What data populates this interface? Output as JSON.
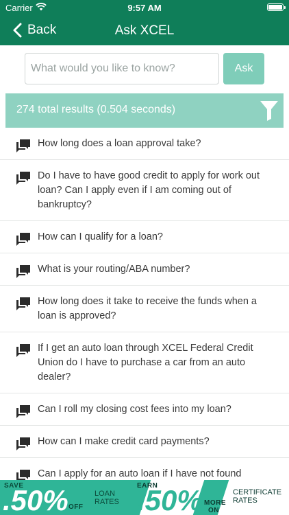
{
  "status_bar": {
    "carrier": "Carrier",
    "time": "9:57 AM"
  },
  "nav": {
    "back_label": "Back",
    "title": "Ask XCEL"
  },
  "search": {
    "placeholder": "What would you like to know?",
    "value": "",
    "ask_label": "Ask"
  },
  "results": {
    "summary": "274 total results (0.504 seconds)"
  },
  "questions": [
    "How long does a loan approval take?",
    "Do I have to have good credit to apply for work out loan? Can I apply even if I am coming out of bankruptcy?",
    "How can I qualify for a loan?",
    "What is your routing/ABA number?",
    "How long does it take to receive the funds when a loan is approved?",
    "If I get an auto loan through XCEL Federal Credit Union do I have to purchase a car from an auto dealer?",
    "Can I roll my closing cost fees into my loan?",
    "How can I make credit card payments?",
    "Can I apply for an auto loan if I have not found"
  ],
  "banner": {
    "left": {
      "top_word": "SAVE",
      "rate": ".50%",
      "small": "OFF",
      "label_line1": "LOAN",
      "label_line2": "RATES"
    },
    "right": {
      "top_word": "EARN",
      "rate": ".50%",
      "small_line1": "MORE",
      "small_line2": "ON",
      "label_line1": "CERTIFICATE",
      "label_line2": "RATES"
    }
  },
  "colors": {
    "header": "#0f7e59",
    "accent": "#8fd2c1",
    "ask_button": "#7fcdb9",
    "banner": "#2fb597"
  },
  "icons": {
    "back": "chevron-left-icon",
    "filter": "filter-funnel-icon",
    "question": "chat-bubble-icon",
    "wifi": "wifi-icon",
    "battery": "battery-icon"
  }
}
